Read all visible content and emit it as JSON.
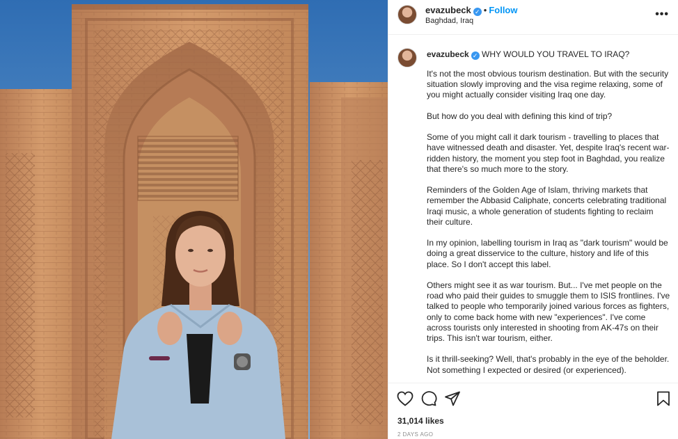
{
  "post": {
    "username": "evazubeck",
    "location": "Baghdad, Iraq",
    "follow_label": "Follow",
    "separator": "•",
    "more_label": "•••",
    "verified_mark": "✓"
  },
  "caption": {
    "username": "evazubeck",
    "title": "WHY WOULD YOU TRAVEL TO IRAQ?",
    "paragraphs": [
      "It's not the most obvious tourism destination. But with the security situation slowly improving and the visa regime relaxing, some of you might actually consider visiting Iraq one day.",
      "But how do you deal with defining this kind of trip?",
      "Some of you might call it dark tourism - travelling to places that have witnessed death and disaster. Yet, despite Iraq's recent war-ridden history, the moment you step foot in Baghdad, you realize that there's so much more to the story.",
      "Reminders of the Golden Age of Islam, thriving markets that remember the Abbasid Caliphate, concerts celebrating traditional Iraqi music, a whole generation of students fighting to reclaim their culture.",
      "In my opinion, labelling tourism in Iraq as \"dark tourism\" would be doing a great disservice to the culture, history and life of this place. So I don't accept this label.",
      "Others might see it as war tourism. But... I've met people on the road who paid their guides to smuggle them to ISIS frontlines. I've talked to people who temporarily joined various forces as fighters, only to come back home with new \"experiences\". I've come across tourists only interested in shooting from AK-47s on their trips. This isn't war tourism, either.",
      "Is it thrill-seeking? Well, that's probably in the eye of the beholder. Not something I expected or desired (or experienced)."
    ]
  },
  "actions": {
    "icons": [
      "heart-icon",
      "comment-icon",
      "share-icon",
      "bookmark-icon"
    ],
    "likes": "31,014 likes",
    "date": "2 DAYS AGO"
  },
  "colors": {
    "link": "#0095f6",
    "verified": "#3897f0",
    "text": "#262626",
    "muted": "#8e8e8e",
    "sky": "#4a86c8",
    "brick": "#c98f62"
  }
}
